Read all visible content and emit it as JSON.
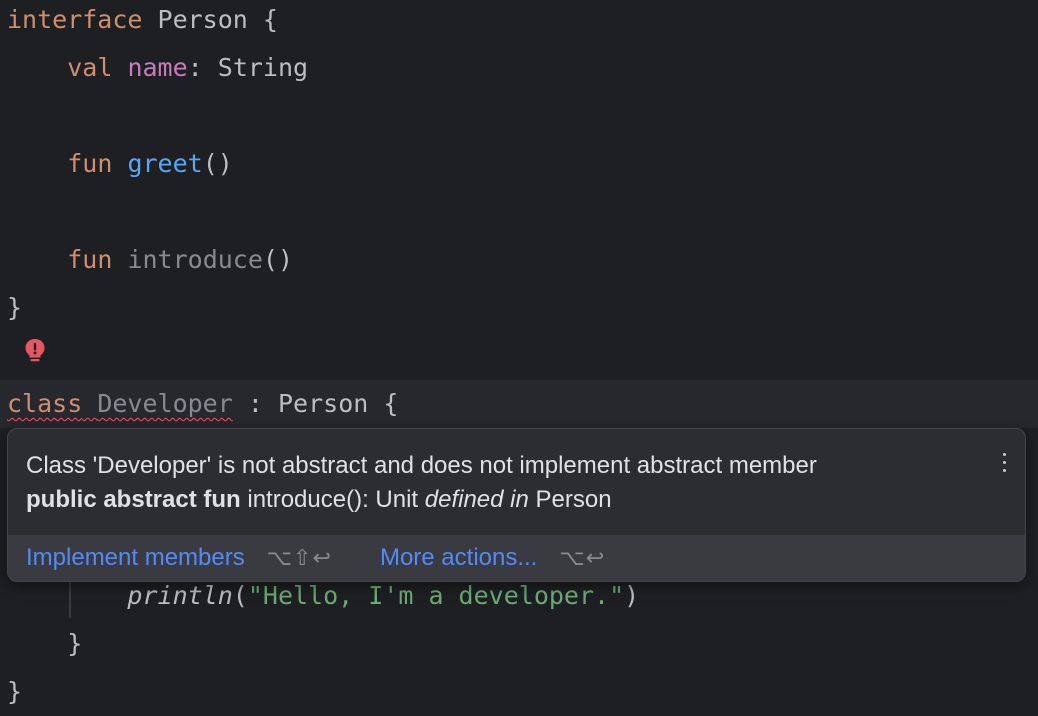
{
  "code": {
    "l1": {
      "kw": "interface",
      "name": "Person",
      "brace": "{"
    },
    "l2": {
      "kw": "val",
      "prop": "name",
      "colon": ":",
      "type": "String"
    },
    "l3": {
      "kw": "fun",
      "fn": "greet",
      "parens": "()"
    },
    "l4": {
      "kw": "fun",
      "fn": "introduce",
      "parens": "()"
    },
    "l5": {
      "brace": "}"
    },
    "l6": {
      "kw": "class",
      "name": "Developer",
      "colon": ":",
      "super": "Person",
      "brace": "{"
    },
    "l7": {
      "fn": "println",
      "open": "(",
      "str": "\"Hello, I'm a developer.\"",
      "close": ")"
    },
    "l8": {
      "brace": "}"
    },
    "l9": {
      "brace": "}"
    }
  },
  "popup": {
    "line1": "Class 'Developer' is not abstract and does not implement abstract member",
    "bold": "public abstract fun",
    "sig": "introduce(): Unit",
    "defined_in": "defined in",
    "owner": "Person",
    "actions": [
      {
        "label": "Implement members",
        "shortcut": "⌥⇧↩"
      },
      {
        "label": "More actions...",
        "shortcut": "⌥↩"
      }
    ]
  },
  "icons": {
    "bulb": "error-bulb-icon",
    "more": "more-vertical-icon"
  },
  "colors": {
    "background": "#1e1f22",
    "keyword": "#cf8e6d",
    "property": "#c77dbb",
    "function": "#56a8f5",
    "string": "#6aab73",
    "error": "#f75464",
    "link": "#548af7"
  }
}
